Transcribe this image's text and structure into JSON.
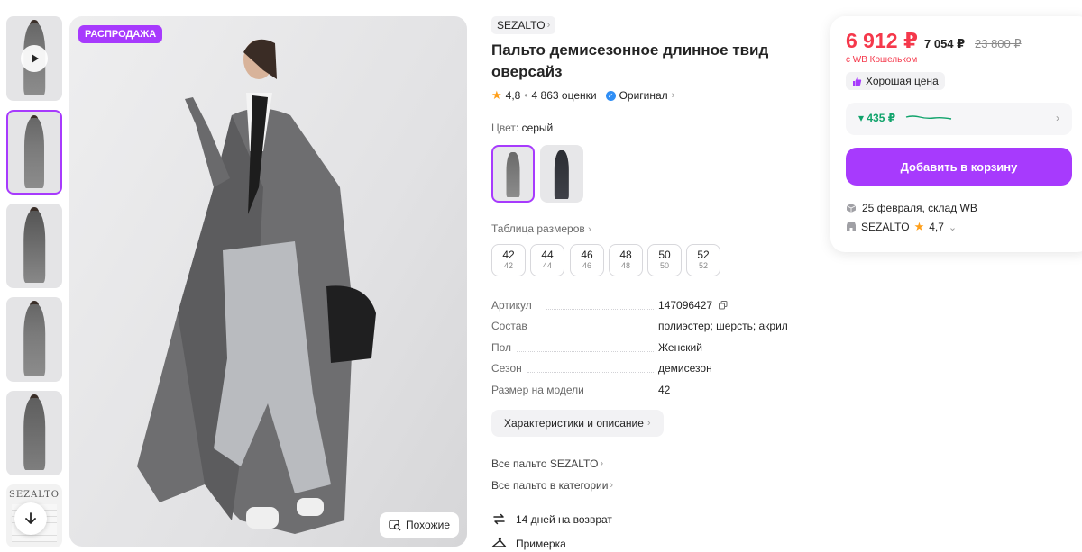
{
  "thumbnails": [
    {
      "kind": "video"
    },
    {
      "kind": "photo",
      "active": true
    },
    {
      "kind": "photo"
    },
    {
      "kind": "photo"
    },
    {
      "kind": "photo"
    },
    {
      "kind": "brand",
      "text": "SEZALTO"
    }
  ],
  "main_image": {
    "badge": "РАСПРОДАЖА",
    "similar_label": "Похожие"
  },
  "product": {
    "brand": "SEZALTO",
    "title": "Пальто демисезонное длинное твид оверсайз",
    "rating": "4,8",
    "reviews": "4 863 оценки",
    "original": "Оригинал",
    "color_label": "Цвет:",
    "color_value": "серый",
    "size_table": "Таблица размеров",
    "sizes": [
      {
        "ru": "42",
        "sub": "42"
      },
      {
        "ru": "44",
        "sub": "44"
      },
      {
        "ru": "46",
        "sub": "46"
      },
      {
        "ru": "48",
        "sub": "48"
      },
      {
        "ru": "50",
        "sub": "50"
      },
      {
        "ru": "52",
        "sub": "52"
      }
    ],
    "specs": [
      {
        "key": "Артикул",
        "value": "147096427"
      },
      {
        "key": "Состав",
        "value": "полиэстер; шерсть; акрил"
      },
      {
        "key": "Пол",
        "value": "Женский"
      },
      {
        "key": "Сезон",
        "value": "демисезон"
      },
      {
        "key": "Размер на модели",
        "value": "42"
      }
    ],
    "char_button": "Характеристики и описание",
    "links": [
      "Все пальто SEZALTO",
      "Все пальто в категории"
    ],
    "services": [
      "14 дней на возврат",
      "Примерка"
    ]
  },
  "card": {
    "price": "6 912 ₽",
    "price_alt": "7 054 ₽",
    "price_old": "23 800 ₽",
    "wallet_note": "с WB Кошельком",
    "good_price": "Хорошая цена",
    "trend_value": "▾ 435 ₽",
    "cart_button": "Добавить в корзину",
    "delivery": "25 февраля, склад WB",
    "seller_name": "SEZALTO",
    "seller_rating": "4,7"
  },
  "colors": {
    "accent": "#a73afd",
    "price": "#f5384b",
    "trend": "#10a36b",
    "star": "#ff9f1a"
  }
}
